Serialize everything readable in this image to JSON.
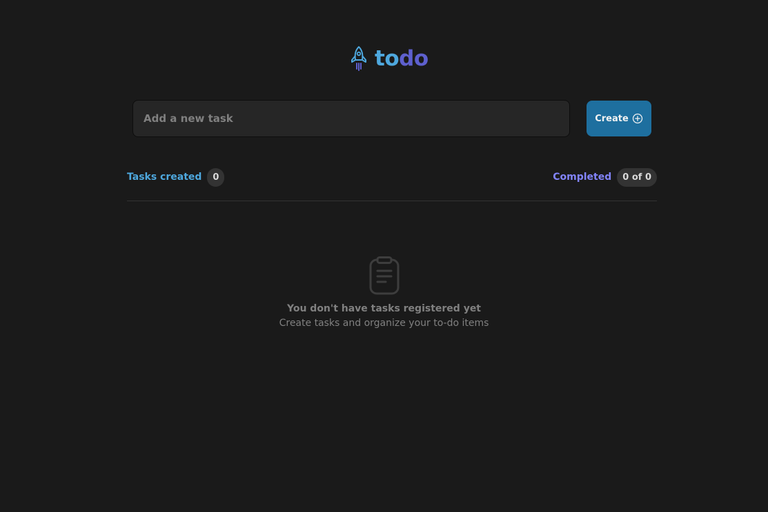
{
  "brand": {
    "icon": "rocket-icon",
    "name_part1": "to",
    "name_part2": "do",
    "color_part1": "#4ea8de",
    "color_part2": "#5e60ce"
  },
  "form": {
    "input_placeholder": "Add a new task",
    "input_value": "",
    "create_label": "Create",
    "create_icon": "plus-circle-icon",
    "create_color": "#1e6f9f"
  },
  "stats": {
    "created_label": "Tasks created",
    "created_count": "0",
    "completed_label": "Completed",
    "completed_count": "0 of 0"
  },
  "empty_state": {
    "icon": "clipboard-icon",
    "title": "You don't have tasks registered yet",
    "subtitle": "Create tasks and organize your to-do items"
  }
}
